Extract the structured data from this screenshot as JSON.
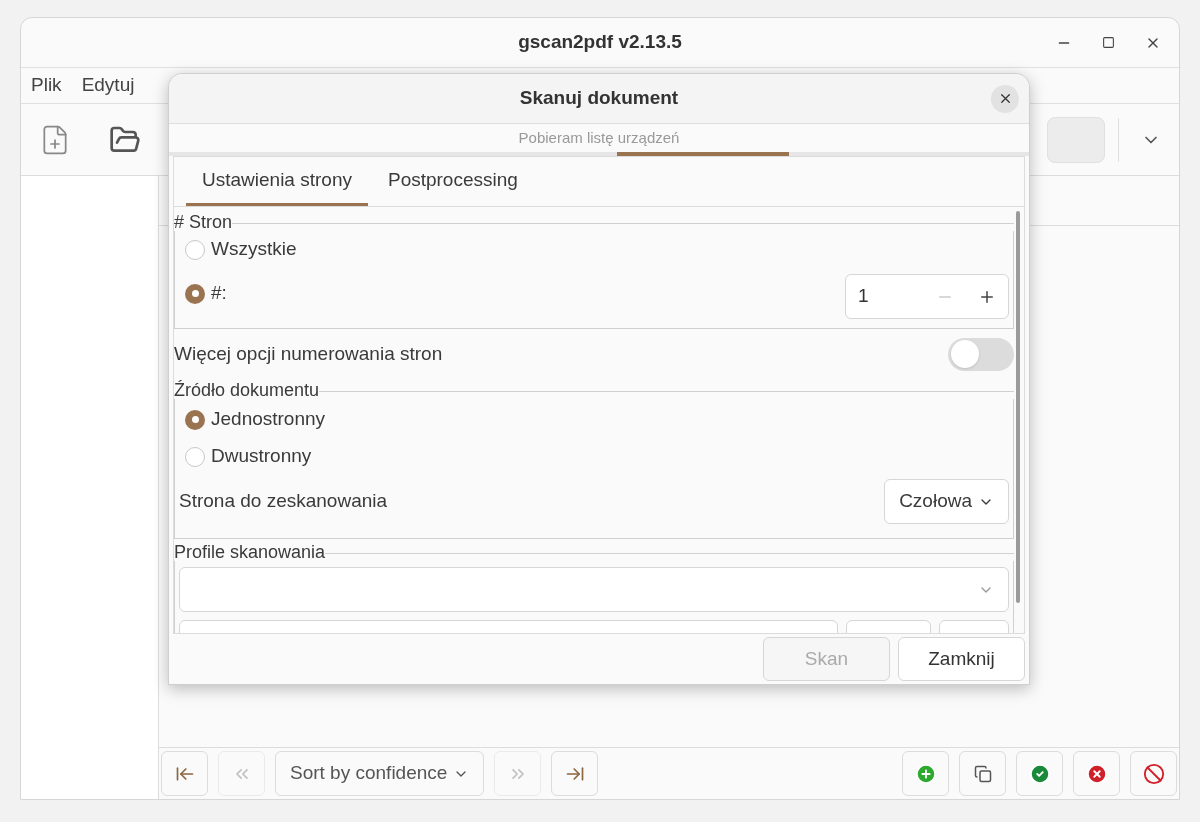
{
  "window": {
    "title": "gscan2pdf v2.13.5"
  },
  "menu": [
    "Plik",
    "Edytuj"
  ],
  "bottom_bar": {
    "sort": "Sort by confidence"
  },
  "dialog": {
    "title": "Skanuj dokument",
    "status": "Pobieram listę urządzeń",
    "tabs": [
      {
        "label": "Ustawienia strony",
        "selected": true
      },
      {
        "label": "Postprocessing",
        "selected": false
      }
    ],
    "pages": {
      "legend": "# Stron",
      "options": [
        {
          "label": "Wszystkie",
          "selected": false
        },
        {
          "label": "#:",
          "selected": true
        }
      ],
      "count": "1"
    },
    "more_numbering": {
      "label": "Więcej opcji numerowania stron",
      "on": false
    },
    "source": {
      "legend": "Źródło dokumentu",
      "options": [
        {
          "label": "Jednostronny",
          "selected": true
        },
        {
          "label": "Dwustronny",
          "selected": false
        }
      ],
      "side_label": "Strona do zeskanowania",
      "side_value": "Czołowa"
    },
    "profiles": {
      "legend": "Profile skanowania"
    },
    "buttons": [
      {
        "label": "Skan",
        "disabled": true
      },
      {
        "label": "Zamknij",
        "disabled": false
      }
    ]
  }
}
